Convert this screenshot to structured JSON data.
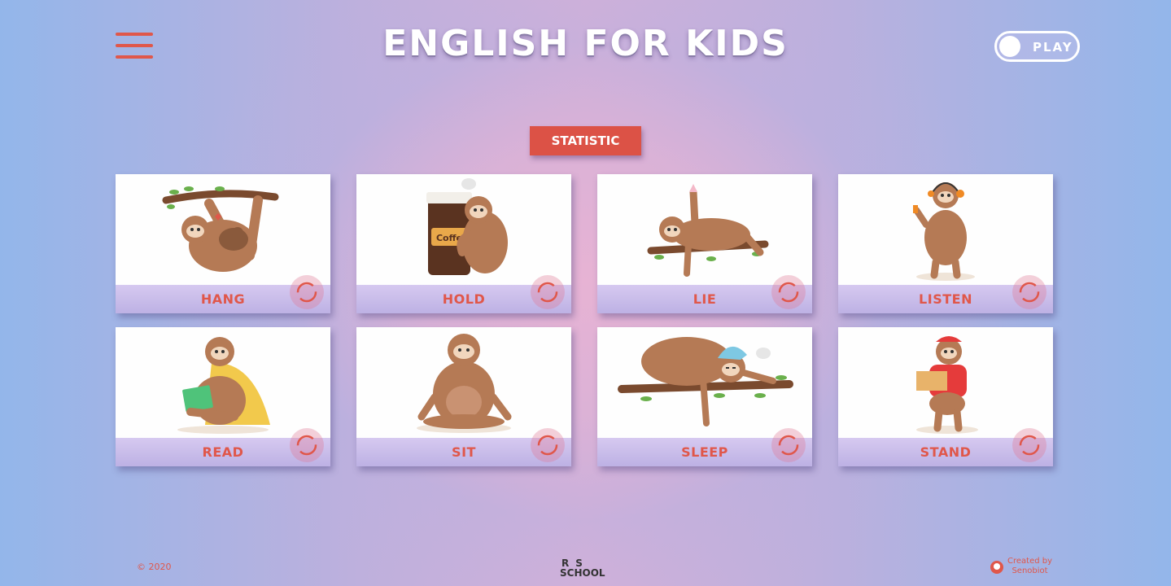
{
  "header": {
    "title": "ENGLISH FOR KIDS",
    "toggle_label": "PLAY"
  },
  "statistic_label": "STATISTIC",
  "cards": [
    {
      "word": "HANG"
    },
    {
      "word": "HOLD"
    },
    {
      "word": "LIE"
    },
    {
      "word": "LISTEN"
    },
    {
      "word": "READ"
    },
    {
      "word": "SIT"
    },
    {
      "word": "SLEEP"
    },
    {
      "word": "STAND"
    }
  ],
  "footer": {
    "year": "© 2020",
    "logo_line1": "RS",
    "logo_line2": "SCHOOL",
    "credit_line1": "Created by",
    "credit_line2": "Senobiot"
  },
  "colors": {
    "accent": "#e0574a",
    "card_bar": "#c9bdea",
    "sloth": "#b57a55"
  }
}
